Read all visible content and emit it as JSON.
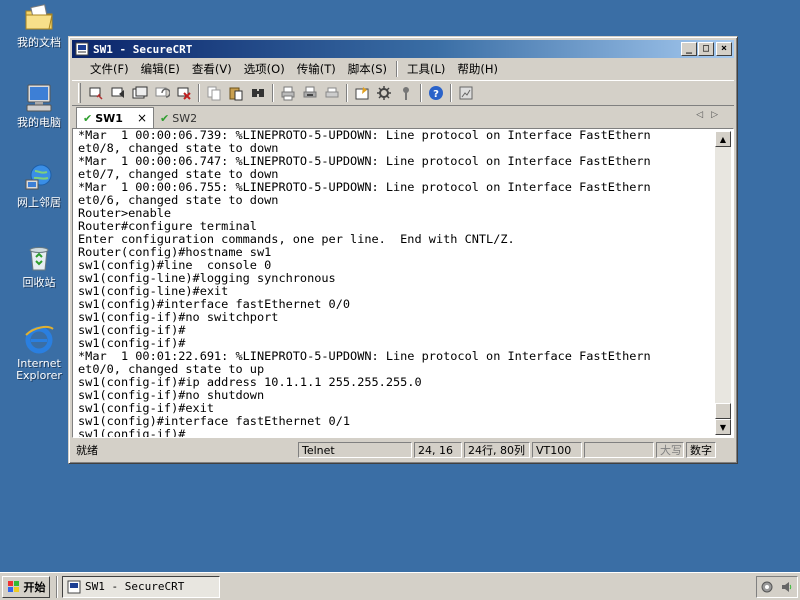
{
  "desktop": {
    "icons": [
      {
        "label": "我的文档",
        "icon": "folder-documents-icon"
      },
      {
        "label": "我的电脑",
        "icon": "computer-icon"
      },
      {
        "label": "网上邻居",
        "icon": "network-icon"
      },
      {
        "label": "回收站",
        "icon": "recycle-bin-icon"
      },
      {
        "label": "Internet Explorer",
        "icon": "internet-explorer-icon"
      }
    ]
  },
  "window": {
    "title": "SW1 - SecureCRT",
    "controls": {
      "minimize": "_",
      "maximize": "□",
      "close": "×"
    }
  },
  "menu": [
    "文件(F)",
    "编辑(E)",
    "查看(V)",
    "选项(O)",
    "传输(T)",
    "脚本(S)",
    "工具(L)",
    "帮助(H)"
  ],
  "toolbar_icons": [
    "connect-icon",
    "quick-connect-icon",
    "connect-tab-icon",
    "reconnect-icon",
    "disconnect-icon",
    "copy-icon",
    "paste-icon",
    "find-icon",
    "print-icon",
    "print-selection-icon",
    "print-setup-icon",
    "session-options-icon",
    "global-options-icon",
    "keymap-icon",
    "help-icon",
    "sftp-icon"
  ],
  "tabs": [
    {
      "label": "SW1",
      "active": true,
      "close": "×"
    },
    {
      "label": "SW2",
      "active": false
    }
  ],
  "tab_nav": {
    "prev": "◁",
    "next": "▷"
  },
  "terminal": {
    "lines": [
      "*Mar  1 00:00:06.739: %LINEPROTO-5-UPDOWN: Line protocol on Interface FastEthern",
      "et0/8, changed state to down",
      "*Mar  1 00:00:06.747: %LINEPROTO-5-UPDOWN: Line protocol on Interface FastEthern",
      "et0/7, changed state to down",
      "*Mar  1 00:00:06.755: %LINEPROTO-5-UPDOWN: Line protocol on Interface FastEthern",
      "et0/6, changed state to down",
      "Router>enable",
      "Router#configure terminal",
      "Enter configuration commands, one per line.  End with CNTL/Z.",
      "Router(config)#hostname sw1",
      "sw1(config)#line  console 0",
      "sw1(config-line)#logging synchronous",
      "sw1(config-line)#exit",
      "sw1(config)#interface fastEthernet 0/0",
      "sw1(config-if)#no switchport",
      "sw1(config-if)#",
      "sw1(config-if)#",
      "*Mar  1 00:01:22.691: %LINEPROTO-5-UPDOWN: Line protocol on Interface FastEthern",
      "et0/0, changed state to up",
      "sw1(config-if)#ip address 10.1.1.1 255.255.255.0",
      "sw1(config-if)#no shutdown",
      "sw1(config-if)#exit",
      "sw1(config)#interface fastEthernet 0/1",
      "sw1(config-if)#"
    ]
  },
  "statusbar": {
    "ready": "就绪",
    "protocol": "Telnet",
    "cursor": "24, 16",
    "size": "24行, 80列",
    "emulation": "VT100",
    "caps": "大写",
    "num": "数字"
  },
  "taskbar": {
    "start": "开始",
    "task": "SW1 - SecureCRT"
  }
}
